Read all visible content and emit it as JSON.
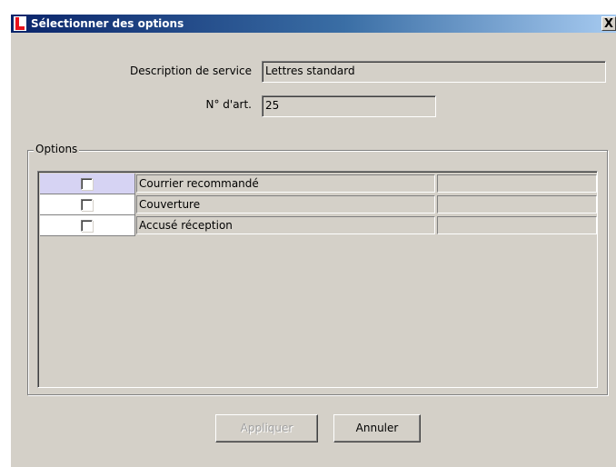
{
  "window": {
    "title": "Sélectionner des options",
    "close_label": "X"
  },
  "form": {
    "description_label": "Description de service",
    "description_value": "Lettres standard",
    "article_label": "N° d'art.",
    "article_value": "25"
  },
  "options": {
    "legend": "Options",
    "rows": [
      {
        "label": "Courrier recommandé",
        "checked": false,
        "selected": true
      },
      {
        "label": "Couverture",
        "checked": false,
        "selected": false
      },
      {
        "label": "Accusé réception",
        "checked": false,
        "selected": false
      }
    ]
  },
  "buttons": {
    "apply_label": "Appliquer",
    "apply_enabled": false,
    "cancel_label": "Annuler"
  },
  "colors": {
    "title_gradient_start": "#0a246a",
    "selected_row": "#d6d3f3",
    "app_icon": "#e8121c"
  }
}
